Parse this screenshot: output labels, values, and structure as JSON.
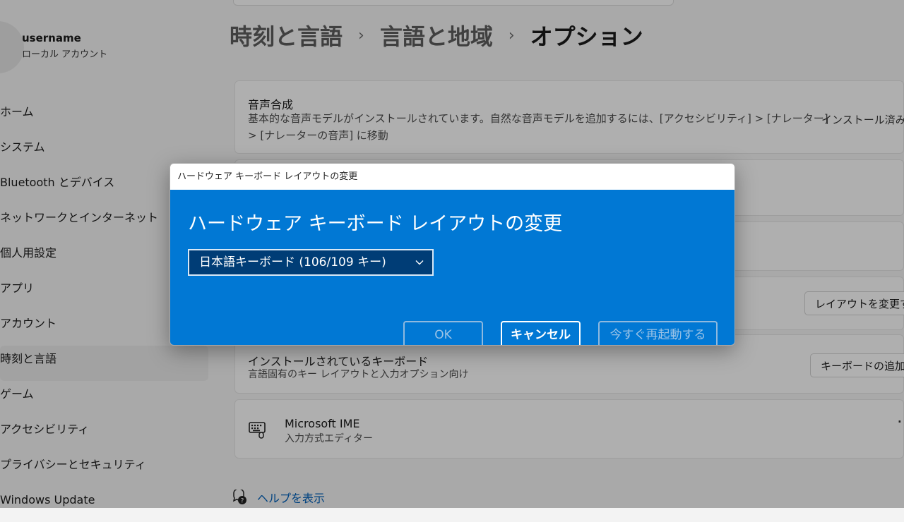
{
  "user": {
    "name": "username",
    "account_type": "ローカル アカウント"
  },
  "nav": {
    "items": [
      {
        "label": "ホーム"
      },
      {
        "label": "システム"
      },
      {
        "label": "Bluetooth とデバイス"
      },
      {
        "label": "ネットワークとインターネット"
      },
      {
        "label": "個人用設定"
      },
      {
        "label": "アプリ"
      },
      {
        "label": "アカウント"
      },
      {
        "label": "時刻と言語",
        "active": true
      },
      {
        "label": "ゲーム"
      },
      {
        "label": "アクセシビリティ"
      },
      {
        "label": "プライバシーとセキュリティ"
      },
      {
        "label": "Windows Update"
      }
    ]
  },
  "breadcrumb": {
    "level1": "時刻と言語",
    "level2": "言語と地域",
    "current": "オプション",
    "separator": "›"
  },
  "speech": {
    "title": "音声合成",
    "description_line1": "基本的な音声モデルがインストールされています。自然な音声モデルを追加するには、[アクセシビリティ] > [ナレーター]",
    "description_line2": "> [ナレーターの音声] に移動",
    "status": "インストール済み"
  },
  "layout_section": {
    "change_button": "レイアウトを変更す"
  },
  "keyboards": {
    "title": "インストールされているキーボード",
    "description": "言語固有のキー レイアウトと入力オプション向け",
    "add_button": "キーボードの追加"
  },
  "ime": {
    "name": "Microsoft IME",
    "description": "入力方式エディター",
    "more": "·"
  },
  "help": {
    "label": "ヘルプを表示"
  },
  "dialog": {
    "window_title": "ハードウェア キーボード レイアウトの変更",
    "heading": "ハードウェア キーボード レイアウトの変更",
    "selected_layout": "日本語キーボード (106/109 キー)",
    "ok_label": "OK",
    "cancel_label": "キャンセル",
    "restart_label": "今すぐ再起動する"
  },
  "colors": {
    "dialog_blue": "#0178d4",
    "select_bg": "#003d76",
    "link": "#005fb8"
  },
  "icons": [
    "chevron-down-icon",
    "keyboard-icon",
    "help-icon"
  ]
}
